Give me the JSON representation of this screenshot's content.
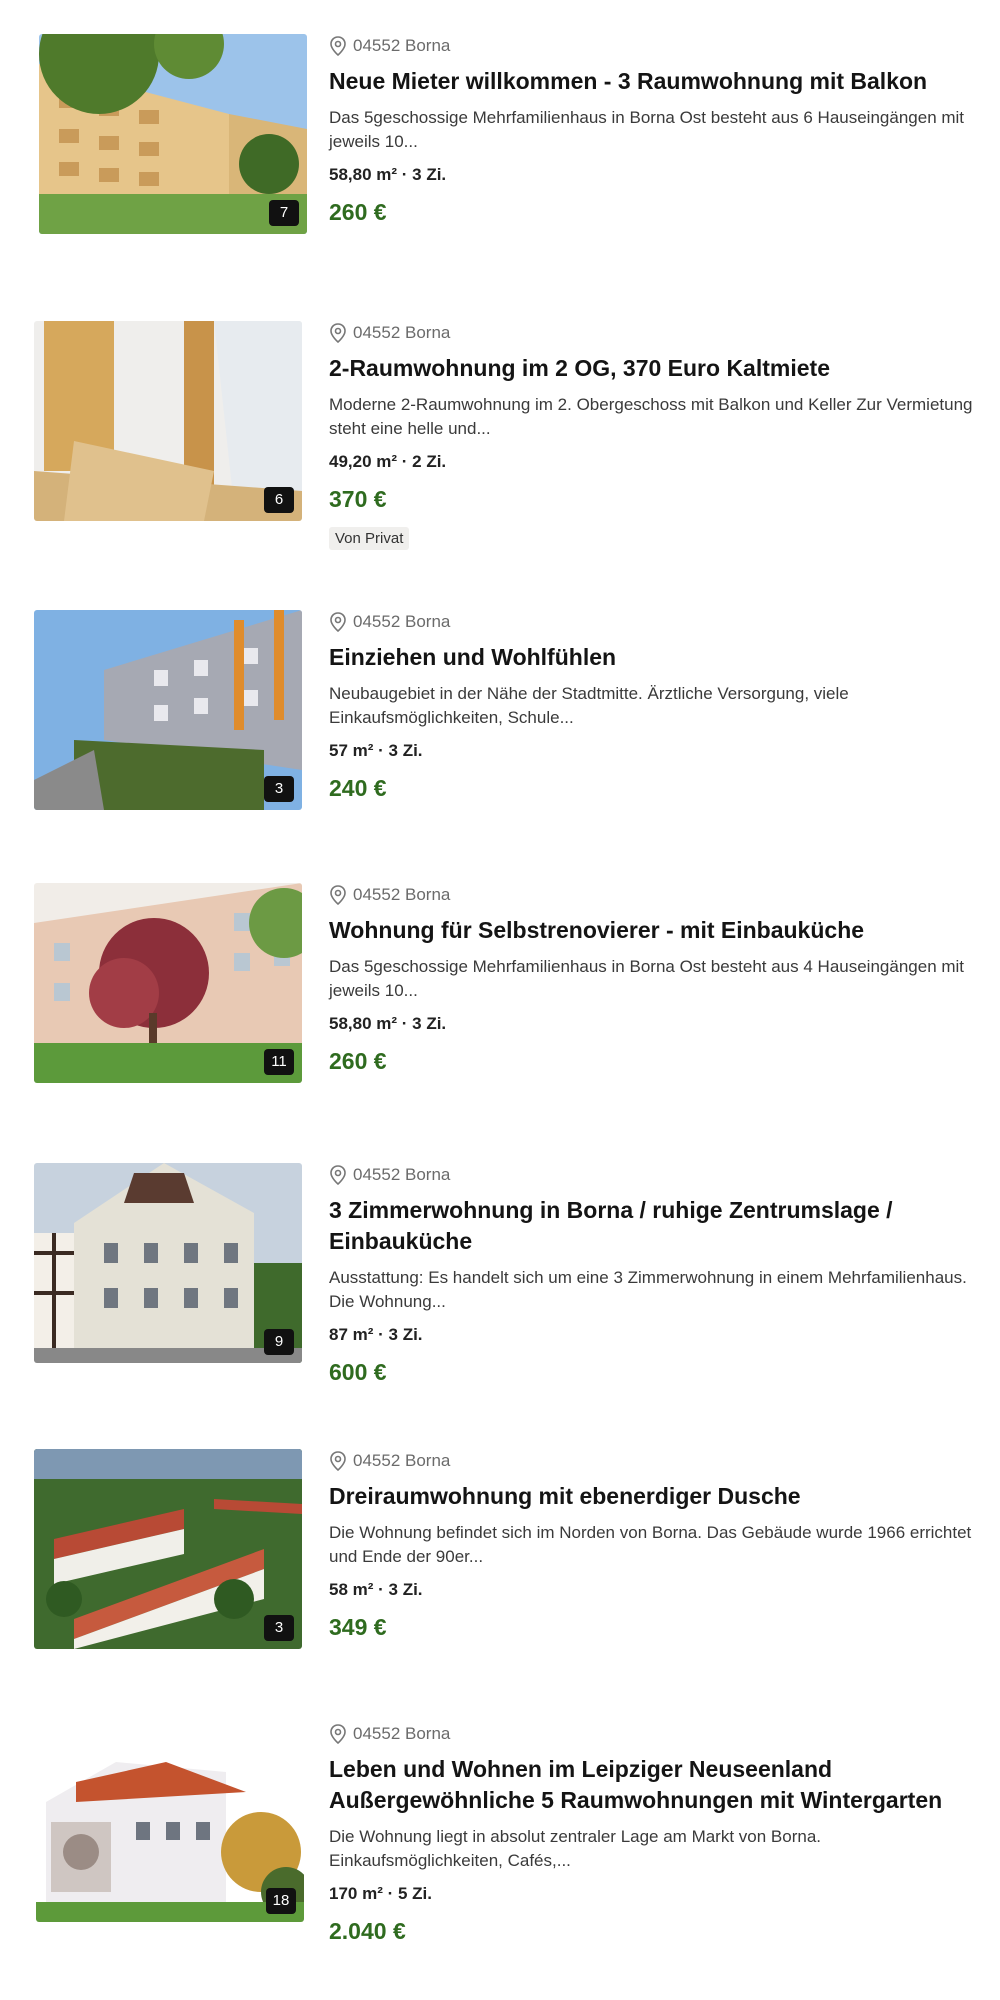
{
  "listings": [
    {
      "location": "04552 Borna",
      "title": "Neue Mieter willkommen - 3 Raumwohnung mit Balkon",
      "description": "Das 5geschossige Mehrfamilienhaus in Borna Ost besteht aus 6 Hauseingängen mit jeweils 10...",
      "facts": "58,80 m² · 3 Zi.",
      "price": "260 €",
      "image_count": "7"
    },
    {
      "location": "04552 Borna",
      "title": "2-Raumwohnung im 2 OG, 370 Euro Kaltmiete",
      "description": "Moderne 2-Raumwohnung im 2. Obergeschoss mit Balkon und Keller Zur Vermietung steht eine helle und...",
      "facts": "49,20 m² · 2 Zi.",
      "price": "370 €",
      "image_count": "6",
      "tag": "Von Privat"
    },
    {
      "location": "04552 Borna",
      "title": "Einziehen und Wohlfühlen",
      "description": "Neubaugebiet in der Nähe der Stadtmitte. Ärztliche Versorgung, viele Einkaufsmöglichkeiten, Schule...",
      "facts": "57 m² · 3 Zi.",
      "price": "240 €",
      "image_count": "3"
    },
    {
      "location": "04552 Borna",
      "title": "Wohnung für Selbstrenovierer - mit Einbauküche",
      "description": "Das 5geschossige Mehrfamilienhaus in Borna Ost besteht aus 4 Hauseingängen mit jeweils 10...",
      "facts": "58,80 m² · 3 Zi.",
      "price": "260 €",
      "image_count": "11"
    },
    {
      "location": "04552 Borna",
      "title": "3 Zimmerwohnung in Borna / ruhige Zentrumslage / Einbauküche",
      "description": "Ausstattung: Es handelt sich um eine 3 Zimmerwohnung in einem Mehrfamilienhaus. Die Wohnung...",
      "facts": "87 m² · 3 Zi.",
      "price": "600 €",
      "image_count": "9"
    },
    {
      "location": "04552 Borna",
      "title": "Dreiraumwohnung mit ebenerdiger Dusche",
      "description": "Die Wohnung befindet sich im Norden von Borna. Das Gebäude wurde 1966 errichtet und Ende der 90er...",
      "facts": "58 m² · 3 Zi.",
      "price": "349 €",
      "image_count": "3"
    },
    {
      "location": "04552 Borna",
      "title": "Leben und Wohnen im Leipziger Neuseenland Außergewöhnliche 5 Raumwohnungen mit Wintergarten",
      "description": "Die Wohnung liegt in absolut zentraler Lage am Markt von Borna. Einkaufsmöglichkeiten, Cafés,...",
      "facts": "170 m² · 5 Zi.",
      "price": "2.040 €",
      "image_count": "18"
    }
  ]
}
